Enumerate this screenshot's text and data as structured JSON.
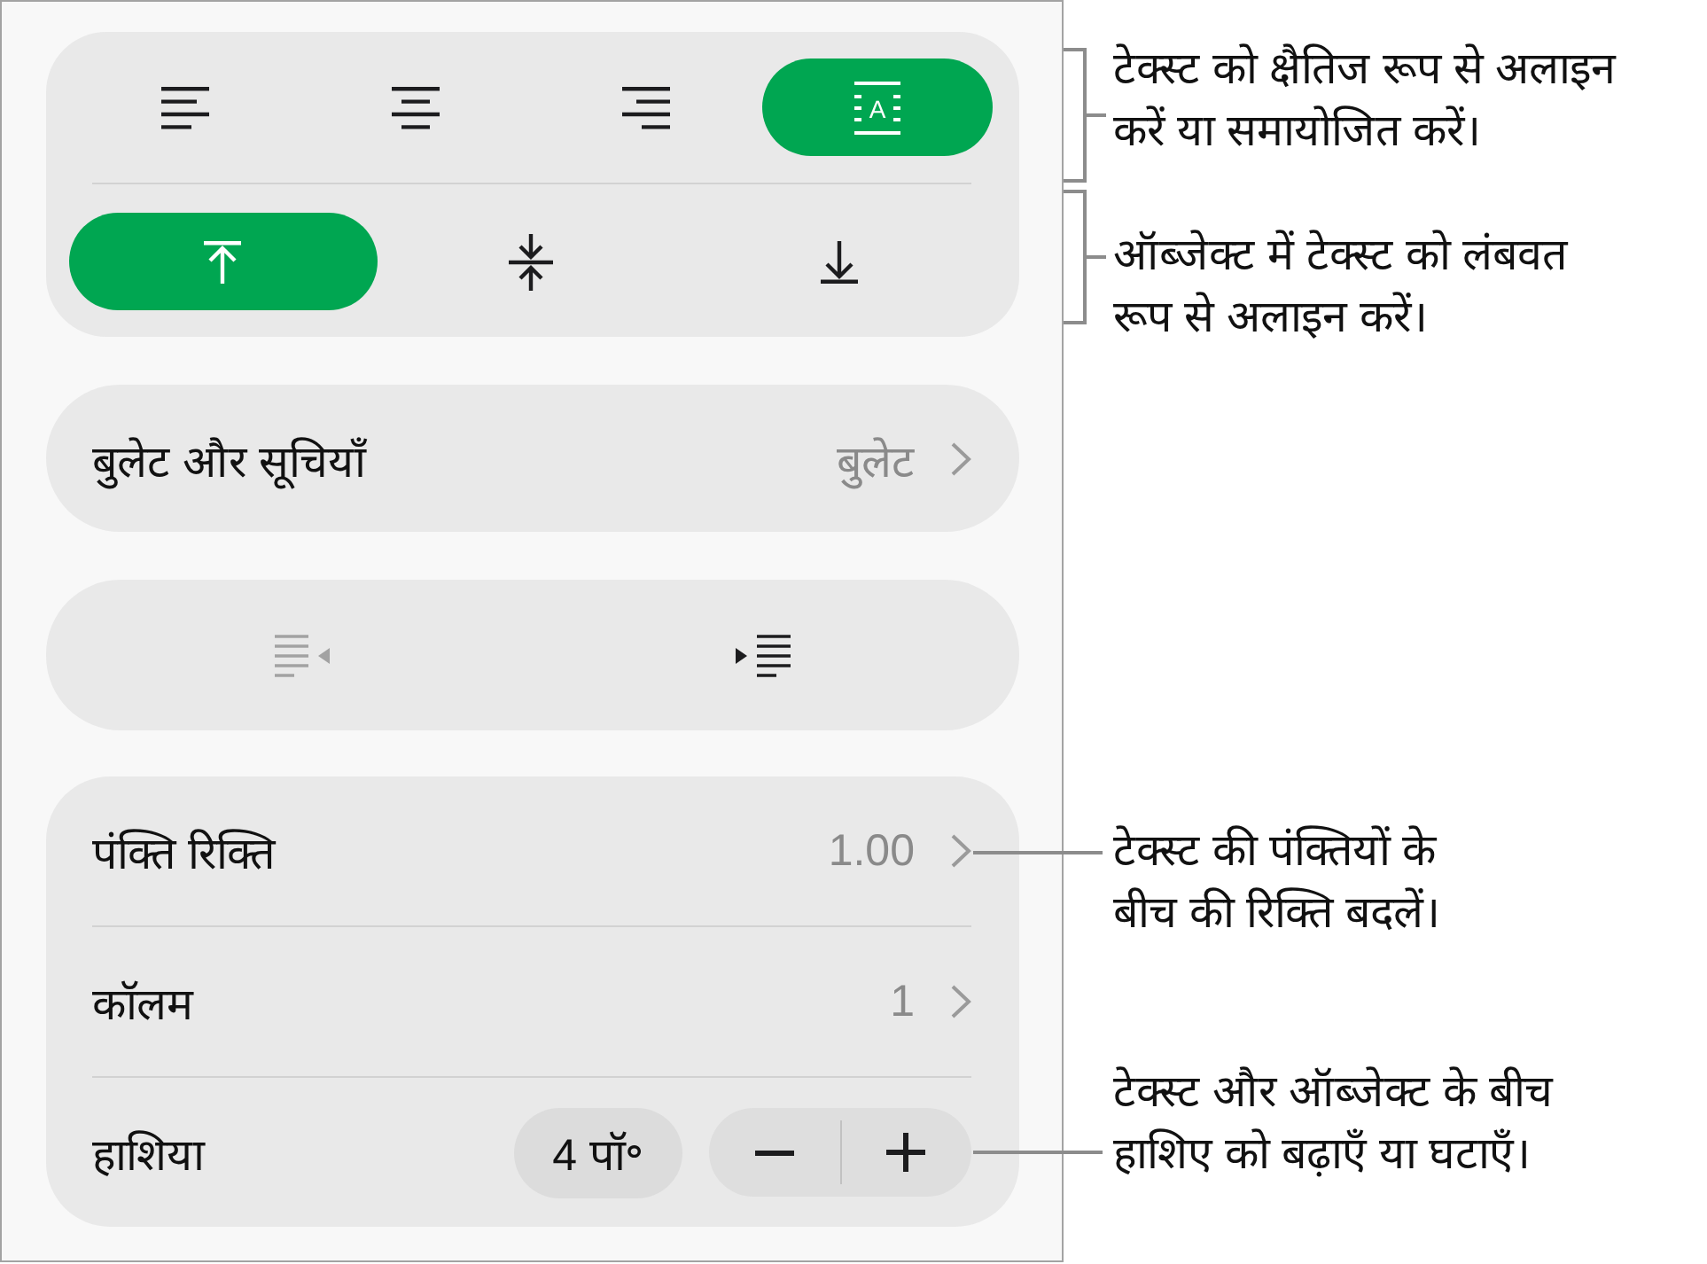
{
  "horizontal_alignment": [
    {
      "kind": "left",
      "selected": false
    },
    {
      "kind": "center",
      "selected": false
    },
    {
      "kind": "right",
      "selected": false
    },
    {
      "kind": "fit",
      "selected": true,
      "glyph": "A"
    }
  ],
  "vertical_alignment": [
    {
      "kind": "top",
      "selected": true
    },
    {
      "kind": "middle",
      "selected": false
    },
    {
      "kind": "bottom",
      "selected": false
    }
  ],
  "bullets_row": {
    "label": "बुलेट और सूचियाँ",
    "value": "बुलेट"
  },
  "indent_buttons": [
    {
      "kind": "decrease",
      "disabled": true
    },
    {
      "kind": "increase",
      "disabled": false
    }
  ],
  "spacing_rows": [
    {
      "kind": "disclosure",
      "label": "पंक्ति रिक्ति",
      "value": "1.00"
    },
    {
      "kind": "disclosure",
      "label": "कॉलम",
      "value": "1"
    },
    {
      "kind": "stepper",
      "label": "हाशिया",
      "value": "4 पॉ॰"
    }
  ],
  "callouts": [
    {
      "kind": "bracket",
      "lines": [
        "टेक्स्ट को क्षैतिज रूप से अलाइन",
        "करें या समायोजित करें।"
      ]
    },
    {
      "kind": "bracket",
      "lines": [
        "ऑब्जेक्ट में टेक्स्ट को लंबवत",
        "रूप से अलाइन करें।"
      ]
    },
    {
      "kind": "leader",
      "lines": [
        "टेक्स्ट की पंक्तियों के",
        "बीच की रिक्ति बदलें।"
      ]
    },
    {
      "kind": "leader",
      "lines": [
        "टेक्स्ट और ऑब्जेक्ट के बीच",
        "हाशिए को बढ़ाएँ या घटाएँ।"
      ]
    }
  ]
}
